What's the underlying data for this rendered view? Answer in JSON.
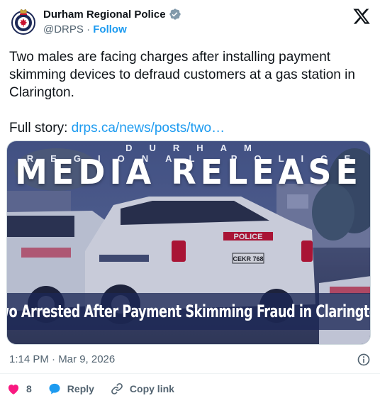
{
  "author": {
    "display_name": "Durham Regional Police",
    "handle": "@DRPS",
    "separator": "·",
    "follow_label": "Follow",
    "verified": true
  },
  "tweet": {
    "line1": "Two males are facing charges after installing payment skimming devices to defraud customers at a gas station in Clarington.",
    "full_story_prefix": "Full story: ",
    "link_text": "drps.ca/news/posts/two…"
  },
  "media": {
    "kicker": "DURHAM REGIONAL POLICE",
    "headline": "MEDIA RELEASE",
    "caption": "Two Arrested After Payment Skimming Fraud in Clarington",
    "vehicle_plate": "CEKR 768",
    "vehicle_label": "POLICE"
  },
  "meta": {
    "timestamp": "1:14 PM · Mar 9, 2026"
  },
  "actions": {
    "like_count": "8",
    "reply_label": "Reply",
    "copy_label": "Copy link"
  },
  "colors": {
    "accent": "#1d9bf0",
    "like": "#f91880",
    "muted": "#536471",
    "band": "#1c2856"
  },
  "icons": [
    "verified-badge-icon",
    "x-logo-icon",
    "info-icon",
    "heart-icon",
    "reply-bubble-icon",
    "link-icon"
  ]
}
